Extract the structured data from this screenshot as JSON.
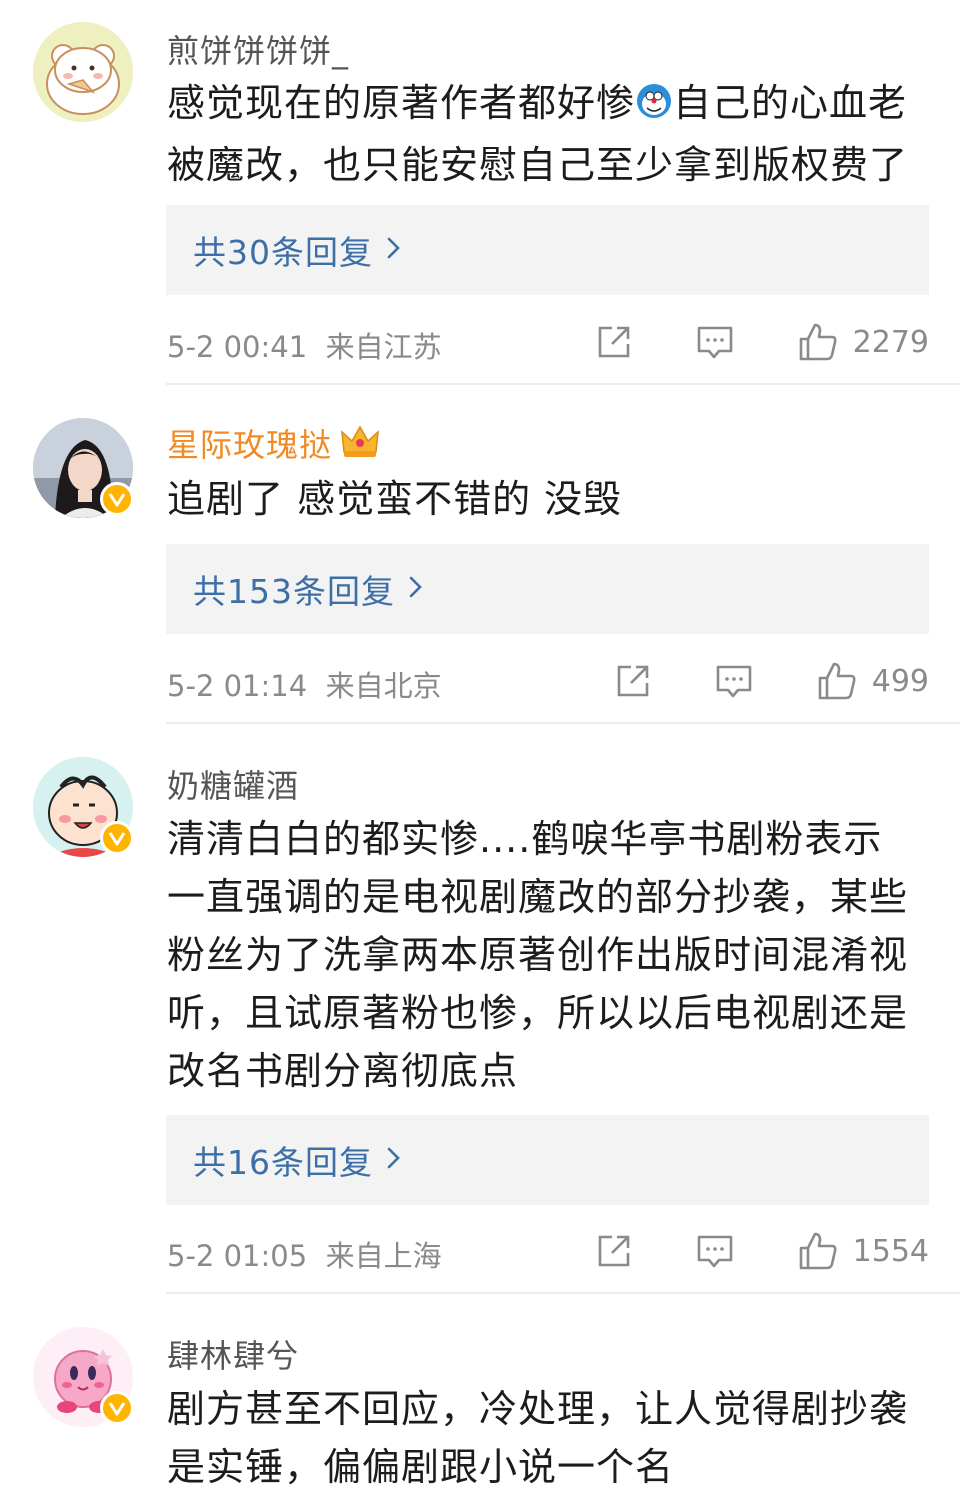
{
  "comments": [
    {
      "user": "煎饼饼饼饼_",
      "text_a": "感觉现在的原著作者都好惨",
      "text_b": "自己的心血老\n被魔改，也只能安慰自己至少拿到版权费了",
      "emoji": "doraemon-emoji",
      "replies": "共30条回复",
      "time": "5-2 00:41",
      "location": "来自江苏",
      "likes": "2279",
      "verified": false
    },
    {
      "user": "星际玫瑰挞",
      "text": "追剧了 感觉蛮不错的 没毁",
      "replies": "共153条回复",
      "time": "5-2 01:14",
      "location": "来自北京",
      "likes": "499",
      "verified": true,
      "vip": true
    },
    {
      "user": "奶糖罐酒",
      "text": "清清白白的都实惨....鹤唳华亭书剧粉表示\n一直强调的是电视剧魔改的部分抄袭，某些\n粉丝为了洗拿两本原著创作出版时间混淆视\n听，且试原著粉也惨，所以以后电视剧还是\n改名书剧分离彻底点",
      "replies": "共16条回复",
      "time": "5-2 01:05",
      "location": "来自上海",
      "likes": "1554",
      "verified": true
    },
    {
      "user": "肆林肆兮",
      "text": "剧方甚至不回应，冷处理，让人觉得剧抄袭\n是实锤，偏偏剧跟小说一个名",
      "verified": true
    }
  ],
  "colors": {
    "reply_link": "#3d6fa6",
    "vip_name": "#f08a24",
    "verified_badge": "#ffb400"
  }
}
